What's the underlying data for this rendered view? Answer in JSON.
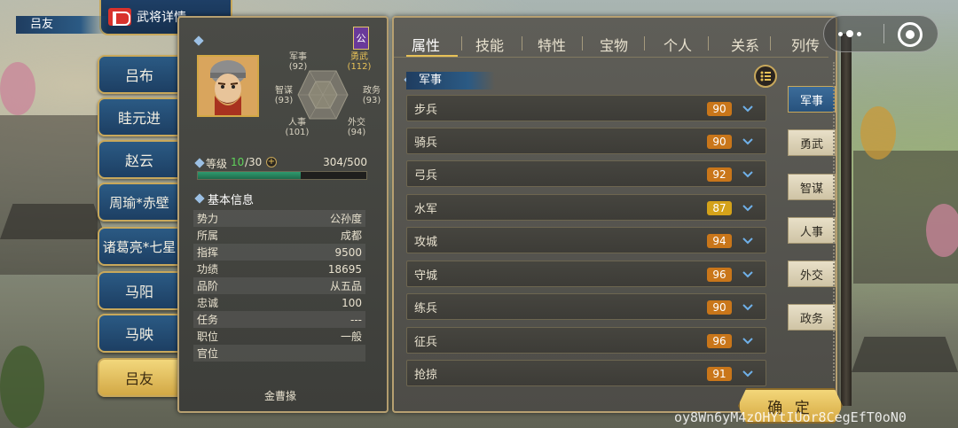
{
  "header": {
    "title": "武将详情"
  },
  "heroes": [
    {
      "label": "吕布"
    },
    {
      "label": "眭元进"
    },
    {
      "label": "赵云"
    },
    {
      "label": "周瑜*赤壁"
    },
    {
      "label": "诸葛亮*七星"
    },
    {
      "label": "马阳"
    },
    {
      "label": "马映"
    },
    {
      "label": "吕友",
      "active": true
    }
  ],
  "profile": {
    "name": "吕友",
    "faction_badge": "公",
    "stats": {
      "military": {
        "label": "军事",
        "value": "(92)"
      },
      "valor": {
        "label": "勇武",
        "value": "(112)"
      },
      "politics": {
        "label": "政务",
        "value": "(93)"
      },
      "diplomacy": {
        "label": "外交",
        "value": "(94)"
      },
      "personnel": {
        "label": "人事",
        "value": "(101)"
      },
      "strategy": {
        "label": "智谋",
        "value": "(93)"
      }
    },
    "level_label": "等级",
    "level_current": "10",
    "level_max": "/30",
    "level_plus": "+",
    "exp_text": "304/500",
    "exp_progress": 0.608
  },
  "basic_info": {
    "title": "基本信息",
    "rows": [
      {
        "label": "势力",
        "value": "公孙度"
      },
      {
        "label": "所属",
        "value": "成都"
      },
      {
        "label": "指挥",
        "value": "9500"
      },
      {
        "label": "功绩",
        "value": "18695"
      },
      {
        "label": "品阶",
        "value": "从五品"
      },
      {
        "label": "忠诚",
        "value": "100"
      },
      {
        "label": "任务",
        "value": "---"
      },
      {
        "label": "职位",
        "value": "一般"
      },
      {
        "label": "官位",
        "value": ""
      }
    ],
    "footer": "金曹掾"
  },
  "tabs": [
    {
      "label": "属性",
      "active": true
    },
    {
      "label": "技能"
    },
    {
      "label": "特性"
    },
    {
      "label": "宝物"
    },
    {
      "label": "个人"
    },
    {
      "label": "关系"
    },
    {
      "label": "列传"
    }
  ],
  "section_title": "军事",
  "skills": [
    {
      "label": "步兵",
      "value": "90",
      "color": "#c9761a"
    },
    {
      "label": "骑兵",
      "value": "90",
      "color": "#c9761a"
    },
    {
      "label": "弓兵",
      "value": "92",
      "color": "#c9761a"
    },
    {
      "label": "水军",
      "value": "87",
      "color": "#d4a21a"
    },
    {
      "label": "攻城",
      "value": "94",
      "color": "#c9761a"
    },
    {
      "label": "守城",
      "value": "96",
      "color": "#c9761a"
    },
    {
      "label": "练兵",
      "value": "90",
      "color": "#c9761a"
    },
    {
      "label": "征兵",
      "value": "96",
      "color": "#c9761a"
    },
    {
      "label": "抢掠",
      "value": "91",
      "color": "#c9761a"
    }
  ],
  "side_tabs": [
    {
      "label": "军事",
      "active": true
    },
    {
      "label": "勇武"
    },
    {
      "label": "智谋"
    },
    {
      "label": "人事"
    },
    {
      "label": "外交"
    },
    {
      "label": "政务"
    }
  ],
  "confirm_label": "确 定",
  "watermark": "oy8Wn6yM4zOHYtIUor8CegEfT0oN0",
  "icons": {
    "more": "more-dots-icon",
    "close": "target-circle-icon",
    "list": "list-icon",
    "chevron": "chevron-down-icon"
  }
}
